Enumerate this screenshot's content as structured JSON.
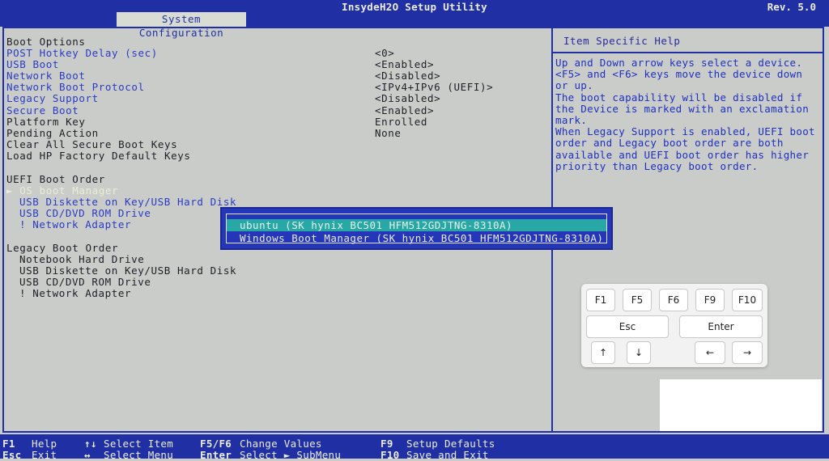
{
  "header": {
    "app_title": "InsydeH2O Setup Utility",
    "version": "Rev. 5.0",
    "active_tab": "System Configuration"
  },
  "settings": {
    "boot_options_heading": "Boot Options",
    "rows": [
      {
        "label": "POST Hotkey Delay (sec)",
        "value": "<0>"
      },
      {
        "label": "USB Boot",
        "value": "<Enabled>"
      },
      {
        "label": "Network Boot",
        "value": "<Disabled>"
      },
      {
        "label": "Network Boot Protocol",
        "value": "<IPv4+IPv6 (UEFI)>"
      },
      {
        "label": "Legacy Support",
        "value": "<Disabled>"
      },
      {
        "label": "Secure Boot",
        "value": "<Enabled>"
      },
      {
        "label": "Platform Key",
        "value": "Enrolled"
      },
      {
        "label": "Pending Action",
        "value": "None"
      },
      {
        "label": "Clear All Secure Boot Keys",
        "value": ""
      },
      {
        "label": "Load HP Factory Default Keys",
        "value": ""
      }
    ],
    "uefi_heading": "UEFI Boot Order",
    "uefi_items": [
      "► OS boot Manager",
      "USB Diskette on Key/USB Hard Disk",
      "USB CD/DVD ROM Drive",
      "! Network Adapter"
    ],
    "legacy_heading": "Legacy Boot Order",
    "legacy_items": [
      "Notebook Hard Drive",
      "USB Diskette on Key/USB Hard Disk",
      "USB CD/DVD ROM Drive",
      "! Network Adapter"
    ]
  },
  "popup": {
    "items": [
      "ubuntu (SK hynix BC501 HFM512GDJTNG-8310A)",
      "Windows Boot Manager (SK hynix BC501 HFM512GDJTNG-8310A)"
    ],
    "selected_index": 0
  },
  "help": {
    "title": "Item Specific Help",
    "lines": [
      "Up and Down arrow keys select a device.",
      "<F5> and <F6> keys move the device down",
      "or up.",
      "The boot capability will be disabled if",
      "the Device is marked with an exclamation",
      "mark.",
      "When Legacy Support is enabled, UEFI boot",
      "order and Legacy boot order are both",
      "available and UEFI boot order has higher",
      "priority than Legacy boot order."
    ]
  },
  "keypad": {
    "row1": [
      "F1",
      "F5",
      "F6",
      "F9",
      "F10"
    ],
    "esc": "Esc",
    "enter": "Enter",
    "up": "↑",
    "down": "↓",
    "left": "←",
    "right": "→"
  },
  "footer": {
    "row1": [
      {
        "key": "F1",
        "desc": "Help"
      },
      {
        "key": "↑↓",
        "desc": "Select Item"
      },
      {
        "key": "F5/F6",
        "desc": "Change Values"
      },
      {
        "key": "F9",
        "desc": "Setup Defaults"
      }
    ],
    "row2": [
      {
        "key": "Esc",
        "desc": "Exit"
      },
      {
        "key": "↔",
        "desc": "Select Menu"
      },
      {
        "key": "Enter",
        "desc": "Select ► SubMenu"
      },
      {
        "key": "F10",
        "desc": "Save and Exit"
      }
    ]
  },
  "colors": {
    "bar": "#2030a4",
    "background": "#c9ccc8",
    "link_blue": "#2b3bc6",
    "selection": "#28a7a7"
  }
}
